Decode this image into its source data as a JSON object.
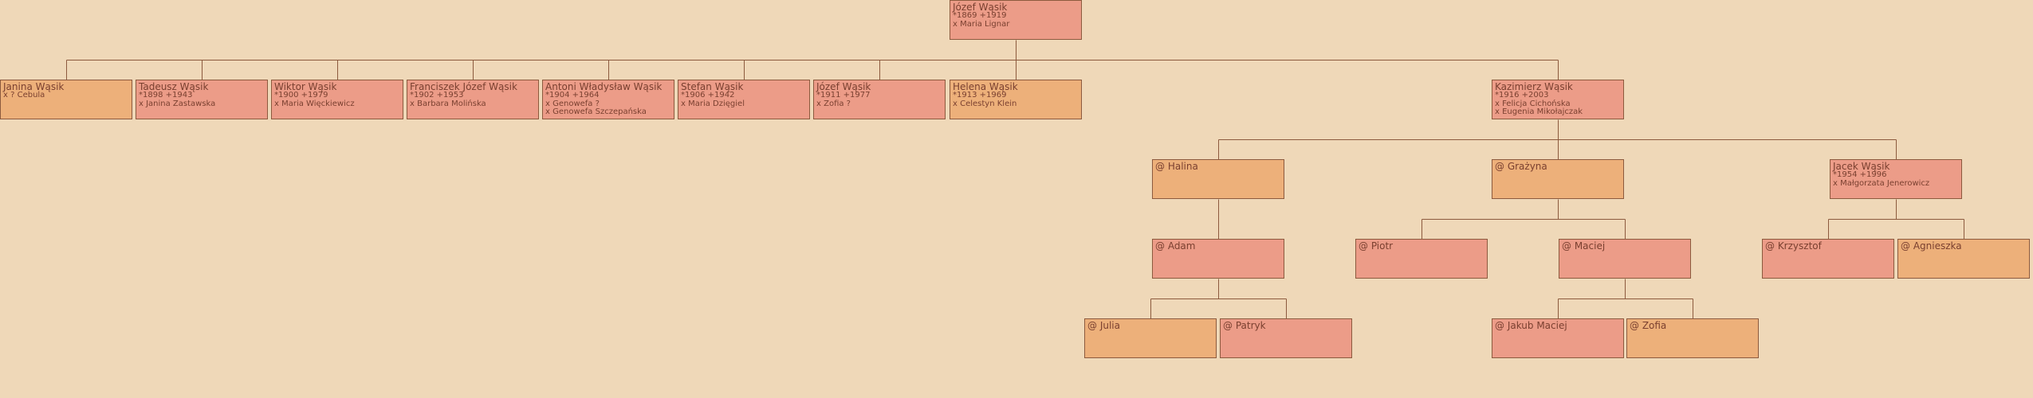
{
  "tree": {
    "nodes": [
      {
        "id": "jozef_root",
        "name": "Józef Wąsik",
        "lines": [
          "*1869 +1919",
          "x Maria Lignar"
        ],
        "sex": "male"
      },
      {
        "id": "janina",
        "name": "Janina Wąsik",
        "lines": [
          "x ? Cebula"
        ],
        "sex": "female"
      },
      {
        "id": "tadeusz",
        "name": "Tadeusz Wąsik",
        "lines": [
          "*1898 +1943",
          "x Janina Zastawska"
        ],
        "sex": "male"
      },
      {
        "id": "wiktor",
        "name": "Wiktor Wąsik",
        "lines": [
          "*1900 +1979",
          "x Maria Więckiewicz"
        ],
        "sex": "male"
      },
      {
        "id": "franciszek",
        "name": "Franciszek Józef Wąsik",
        "lines": [
          "*1902 +1953",
          "x Barbara Molińska"
        ],
        "sex": "male"
      },
      {
        "id": "antoni",
        "name": "Antoni Władysław Wąsik",
        "lines": [
          "*1904 +1964",
          "x Genowefa ?",
          "x Genowefa Szczepańska"
        ],
        "sex": "male"
      },
      {
        "id": "stefan",
        "name": "Stefan Wąsik",
        "lines": [
          "*1906 +1942",
          "x Maria Dzięgiel"
        ],
        "sex": "male"
      },
      {
        "id": "jozef2",
        "name": "Józef Wąsik",
        "lines": [
          "*1911 +1977",
          "x Zofia ?"
        ],
        "sex": "male"
      },
      {
        "id": "helena",
        "name": "Helena Wąsik",
        "lines": [
          "*1913 +1969",
          "x Celestyn Klein"
        ],
        "sex": "female"
      },
      {
        "id": "kazimierz",
        "name": "Kazimierz Wąsik",
        "lines": [
          "*1916 +2003",
          "x Felicja Cichońska",
          "x Eugenia Mikołajczak"
        ],
        "sex": "male"
      },
      {
        "id": "halina",
        "name": "@ Halina",
        "lines": [],
        "sex": "female"
      },
      {
        "id": "grazyna",
        "name": "@ Grażyna",
        "lines": [],
        "sex": "female"
      },
      {
        "id": "jacek",
        "name": "Jacek Wąsik",
        "lines": [
          "*1954 +1996",
          "x Małgorzata Jenerowicz"
        ],
        "sex": "male"
      },
      {
        "id": "adam",
        "name": "@ Adam",
        "lines": [],
        "sex": "male"
      },
      {
        "id": "piotr",
        "name": "@ Piotr",
        "lines": [],
        "sex": "male"
      },
      {
        "id": "maciej",
        "name": "@ Maciej",
        "lines": [],
        "sex": "male"
      },
      {
        "id": "krzysztof",
        "name": "@ Krzysztof",
        "lines": [],
        "sex": "male"
      },
      {
        "id": "agnieszka",
        "name": "@ Agnieszka",
        "lines": [],
        "sex": "female"
      },
      {
        "id": "julia",
        "name": "@ Julia",
        "lines": [],
        "sex": "female"
      },
      {
        "id": "patryk",
        "name": "@ Patryk",
        "lines": [],
        "sex": "male"
      },
      {
        "id": "jakub",
        "name": "@ Jakub Maciej",
        "lines": [],
        "sex": "male"
      },
      {
        "id": "zofia",
        "name": "@ Zofia",
        "lines": [],
        "sex": "female"
      }
    ],
    "edges": [
      {
        "parent": "jozef_root",
        "children": [
          "janina",
          "tadeusz",
          "wiktor",
          "franciszek",
          "antoni",
          "stefan",
          "jozef2",
          "helena",
          "kazimierz"
        ]
      },
      {
        "parent": "kazimierz",
        "children": [
          "halina",
          "grazyna",
          "jacek"
        ]
      },
      {
        "parent": "halina",
        "children": [
          "adam"
        ]
      },
      {
        "parent": "grazyna",
        "children": [
          "piotr",
          "maciej"
        ]
      },
      {
        "parent": "jacek",
        "children": [
          "krzysztof",
          "agnieszka"
        ]
      },
      {
        "parent": "adam",
        "children": [
          "julia",
          "patryk"
        ]
      },
      {
        "parent": "maciej",
        "children": [
          "jakub",
          "zofia"
        ]
      }
    ],
    "colors": {
      "male": "#EC9C88",
      "female": "#EDB07A",
      "line": "#8C5A3E",
      "text": "#7A4030",
      "background": "#EFD8B8"
    }
  }
}
